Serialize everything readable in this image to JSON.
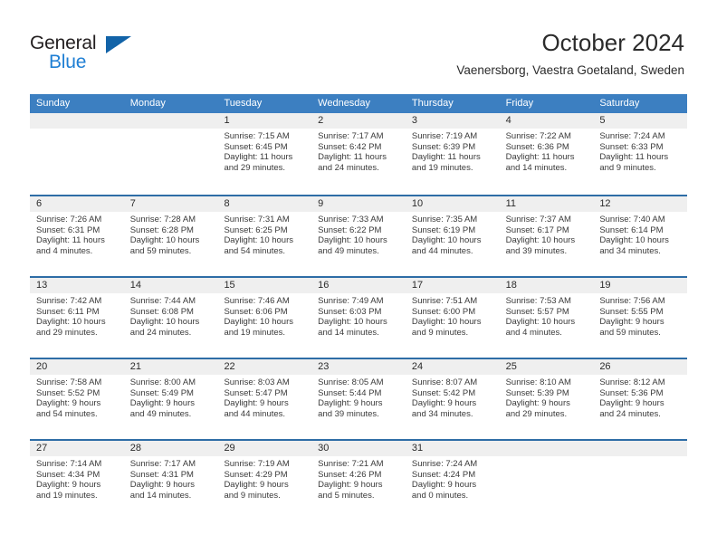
{
  "brand": {
    "name_top": "General",
    "name_bottom": "Blue",
    "triangle_icon": "triangle-icon",
    "accent_color": "#1f7fd4",
    "dark_color": "#231f20"
  },
  "header": {
    "title": "October 2024",
    "subtitle": "Vaenersborg, Vaestra Goetaland, Sweden"
  },
  "calendar": {
    "header_bg": "#3c7fc1",
    "row_divider": "#2e6da6",
    "daynum_bg": "#efefef",
    "weekdays": [
      "Sunday",
      "Monday",
      "Tuesday",
      "Wednesday",
      "Thursday",
      "Friday",
      "Saturday"
    ],
    "weeks": [
      [
        {
          "date": "",
          "empty": true
        },
        {
          "date": "",
          "empty": true
        },
        {
          "date": "1",
          "sunrise": "Sunrise: 7:15 AM",
          "sunset": "Sunset: 6:45 PM",
          "daylight_1": "Daylight: 11 hours",
          "daylight_2": "and 29 minutes."
        },
        {
          "date": "2",
          "sunrise": "Sunrise: 7:17 AM",
          "sunset": "Sunset: 6:42 PM",
          "daylight_1": "Daylight: 11 hours",
          "daylight_2": "and 24 minutes."
        },
        {
          "date": "3",
          "sunrise": "Sunrise: 7:19 AM",
          "sunset": "Sunset: 6:39 PM",
          "daylight_1": "Daylight: 11 hours",
          "daylight_2": "and 19 minutes."
        },
        {
          "date": "4",
          "sunrise": "Sunrise: 7:22 AM",
          "sunset": "Sunset: 6:36 PM",
          "daylight_1": "Daylight: 11 hours",
          "daylight_2": "and 14 minutes."
        },
        {
          "date": "5",
          "sunrise": "Sunrise: 7:24 AM",
          "sunset": "Sunset: 6:33 PM",
          "daylight_1": "Daylight: 11 hours",
          "daylight_2": "and 9 minutes."
        }
      ],
      [
        {
          "date": "6",
          "sunrise": "Sunrise: 7:26 AM",
          "sunset": "Sunset: 6:31 PM",
          "daylight_1": "Daylight: 11 hours",
          "daylight_2": "and 4 minutes."
        },
        {
          "date": "7",
          "sunrise": "Sunrise: 7:28 AM",
          "sunset": "Sunset: 6:28 PM",
          "daylight_1": "Daylight: 10 hours",
          "daylight_2": "and 59 minutes."
        },
        {
          "date": "8",
          "sunrise": "Sunrise: 7:31 AM",
          "sunset": "Sunset: 6:25 PM",
          "daylight_1": "Daylight: 10 hours",
          "daylight_2": "and 54 minutes."
        },
        {
          "date": "9",
          "sunrise": "Sunrise: 7:33 AM",
          "sunset": "Sunset: 6:22 PM",
          "daylight_1": "Daylight: 10 hours",
          "daylight_2": "and 49 minutes."
        },
        {
          "date": "10",
          "sunrise": "Sunrise: 7:35 AM",
          "sunset": "Sunset: 6:19 PM",
          "daylight_1": "Daylight: 10 hours",
          "daylight_2": "and 44 minutes."
        },
        {
          "date": "11",
          "sunrise": "Sunrise: 7:37 AM",
          "sunset": "Sunset: 6:17 PM",
          "daylight_1": "Daylight: 10 hours",
          "daylight_2": "and 39 minutes."
        },
        {
          "date": "12",
          "sunrise": "Sunrise: 7:40 AM",
          "sunset": "Sunset: 6:14 PM",
          "daylight_1": "Daylight: 10 hours",
          "daylight_2": "and 34 minutes."
        }
      ],
      [
        {
          "date": "13",
          "sunrise": "Sunrise: 7:42 AM",
          "sunset": "Sunset: 6:11 PM",
          "daylight_1": "Daylight: 10 hours",
          "daylight_2": "and 29 minutes."
        },
        {
          "date": "14",
          "sunrise": "Sunrise: 7:44 AM",
          "sunset": "Sunset: 6:08 PM",
          "daylight_1": "Daylight: 10 hours",
          "daylight_2": "and 24 minutes."
        },
        {
          "date": "15",
          "sunrise": "Sunrise: 7:46 AM",
          "sunset": "Sunset: 6:06 PM",
          "daylight_1": "Daylight: 10 hours",
          "daylight_2": "and 19 minutes."
        },
        {
          "date": "16",
          "sunrise": "Sunrise: 7:49 AM",
          "sunset": "Sunset: 6:03 PM",
          "daylight_1": "Daylight: 10 hours",
          "daylight_2": "and 14 minutes."
        },
        {
          "date": "17",
          "sunrise": "Sunrise: 7:51 AM",
          "sunset": "Sunset: 6:00 PM",
          "daylight_1": "Daylight: 10 hours",
          "daylight_2": "and 9 minutes."
        },
        {
          "date": "18",
          "sunrise": "Sunrise: 7:53 AM",
          "sunset": "Sunset: 5:57 PM",
          "daylight_1": "Daylight: 10 hours",
          "daylight_2": "and 4 minutes."
        },
        {
          "date": "19",
          "sunrise": "Sunrise: 7:56 AM",
          "sunset": "Sunset: 5:55 PM",
          "daylight_1": "Daylight: 9 hours",
          "daylight_2": "and 59 minutes."
        }
      ],
      [
        {
          "date": "20",
          "sunrise": "Sunrise: 7:58 AM",
          "sunset": "Sunset: 5:52 PM",
          "daylight_1": "Daylight: 9 hours",
          "daylight_2": "and 54 minutes."
        },
        {
          "date": "21",
          "sunrise": "Sunrise: 8:00 AM",
          "sunset": "Sunset: 5:49 PM",
          "daylight_1": "Daylight: 9 hours",
          "daylight_2": "and 49 minutes."
        },
        {
          "date": "22",
          "sunrise": "Sunrise: 8:03 AM",
          "sunset": "Sunset: 5:47 PM",
          "daylight_1": "Daylight: 9 hours",
          "daylight_2": "and 44 minutes."
        },
        {
          "date": "23",
          "sunrise": "Sunrise: 8:05 AM",
          "sunset": "Sunset: 5:44 PM",
          "daylight_1": "Daylight: 9 hours",
          "daylight_2": "and 39 minutes."
        },
        {
          "date": "24",
          "sunrise": "Sunrise: 8:07 AM",
          "sunset": "Sunset: 5:42 PM",
          "daylight_1": "Daylight: 9 hours",
          "daylight_2": "and 34 minutes."
        },
        {
          "date": "25",
          "sunrise": "Sunrise: 8:10 AM",
          "sunset": "Sunset: 5:39 PM",
          "daylight_1": "Daylight: 9 hours",
          "daylight_2": "and 29 minutes."
        },
        {
          "date": "26",
          "sunrise": "Sunrise: 8:12 AM",
          "sunset": "Sunset: 5:36 PM",
          "daylight_1": "Daylight: 9 hours",
          "daylight_2": "and 24 minutes."
        }
      ],
      [
        {
          "date": "27",
          "sunrise": "Sunrise: 7:14 AM",
          "sunset": "Sunset: 4:34 PM",
          "daylight_1": "Daylight: 9 hours",
          "daylight_2": "and 19 minutes."
        },
        {
          "date": "28",
          "sunrise": "Sunrise: 7:17 AM",
          "sunset": "Sunset: 4:31 PM",
          "daylight_1": "Daylight: 9 hours",
          "daylight_2": "and 14 minutes."
        },
        {
          "date": "29",
          "sunrise": "Sunrise: 7:19 AM",
          "sunset": "Sunset: 4:29 PM",
          "daylight_1": "Daylight: 9 hours",
          "daylight_2": "and 9 minutes."
        },
        {
          "date": "30",
          "sunrise": "Sunrise: 7:21 AM",
          "sunset": "Sunset: 4:26 PM",
          "daylight_1": "Daylight: 9 hours",
          "daylight_2": "and 5 minutes."
        },
        {
          "date": "31",
          "sunrise": "Sunrise: 7:24 AM",
          "sunset": "Sunset: 4:24 PM",
          "daylight_1": "Daylight: 9 hours",
          "daylight_2": "and 0 minutes."
        },
        {
          "date": "",
          "empty": true
        },
        {
          "date": "",
          "empty": true
        }
      ]
    ]
  }
}
